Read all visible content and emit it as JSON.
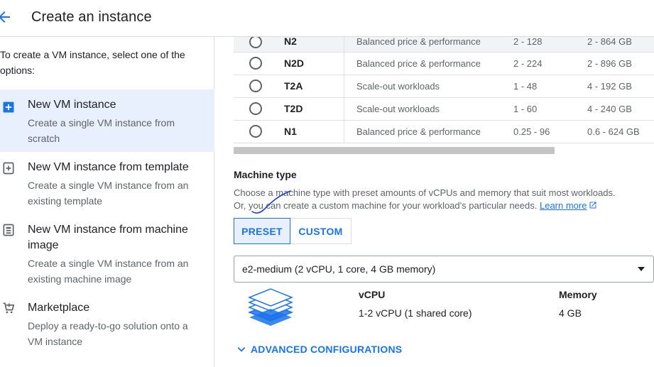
{
  "header": {
    "title": "Create an instance"
  },
  "sidebar": {
    "intro": "To create a VM instance, select one of the options:",
    "options": [
      {
        "title": "New VM instance",
        "desc": "Create a single VM instance from scratch",
        "icon": "add-box-icon",
        "selected": true
      },
      {
        "title": "New VM instance from template",
        "desc": "Create a single VM instance from an existing template",
        "icon": "template-add-icon",
        "selected": false
      },
      {
        "title": "New VM instance from machine image",
        "desc": "Create a single VM instance from an existing machine image",
        "icon": "machine-image-icon",
        "selected": false
      },
      {
        "title": "Marketplace",
        "desc": "Deploy a ready-to-go solution onto a VM instance",
        "icon": "cart-icon",
        "selected": false
      }
    ]
  },
  "machine_series": [
    {
      "name": "N2",
      "description": "Balanced price & performance",
      "vcpus": "2 - 128",
      "memory": "2 - 864 GB"
    },
    {
      "name": "N2D",
      "description": "Balanced price & performance",
      "vcpus": "2 - 224",
      "memory": "2 - 896 GB"
    },
    {
      "name": "T2A",
      "description": "Scale-out workloads",
      "vcpus": "1 - 48",
      "memory": "4 - 192 GB"
    },
    {
      "name": "T2D",
      "description": "Scale-out workloads",
      "vcpus": "1 - 60",
      "memory": "4 - 240 GB"
    },
    {
      "name": "N1",
      "description": "Balanced price & performance",
      "vcpus": "0.25 - 96",
      "memory": "0.6 - 624 GB"
    }
  ],
  "machine_type": {
    "title": "Machine type",
    "desc_line1": "Choose a machine type with preset amounts of vCPUs and memory that suit most workloads.",
    "desc_line2": "Or, you can create a custom machine for your workload's particular needs.",
    "learn_more": "Learn more",
    "tabs": {
      "preset": "PRESET",
      "custom": "CUSTOM",
      "active": "PRESET"
    },
    "selected": "e2-medium (2 vCPU, 1 core, 4 GB memory)",
    "specs": {
      "vcpu_label": "vCPU",
      "vcpu_value": "1-2 vCPU (1 shared core)",
      "memory_label": "Memory",
      "memory_value": "4 GB"
    },
    "advanced": "ADVANCED CONFIGURATIONS"
  },
  "colors": {
    "accent": "#1a73e8",
    "selected_bg": "#e8f0fe",
    "scribble": "#1a3fd6"
  }
}
